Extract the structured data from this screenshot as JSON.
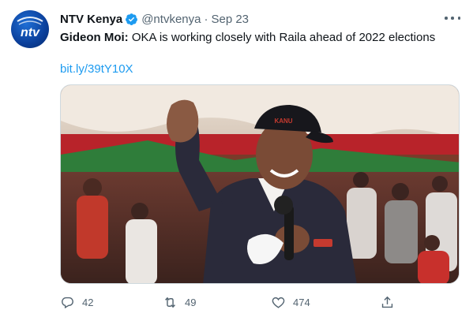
{
  "tweet": {
    "author_name": "NTV Kenya",
    "handle": "@ntvkenya",
    "separator": "·",
    "date": "Sep 23",
    "text_bold": "Gideon Moi:",
    "text_rest": " OKA is working closely with Raila ahead of 2022 elections",
    "link": "bit.ly/39tY10X",
    "avatar_text": "ntv",
    "cap_text": "KANU",
    "counts": {
      "replies": "42",
      "retweets": "49",
      "likes": "474"
    }
  },
  "icons": {
    "verified": "verified-badge-icon",
    "more": "more-options-icon",
    "reply": "reply-icon",
    "retweet": "retweet-icon",
    "like": "heart-icon",
    "share": "share-icon"
  },
  "colors": {
    "link": "#1d9bf0",
    "secondary_text": "#536471",
    "primary_text": "#0f1419",
    "verified": "#1d9bf0",
    "avatar_blue": "#0b3f9a"
  }
}
